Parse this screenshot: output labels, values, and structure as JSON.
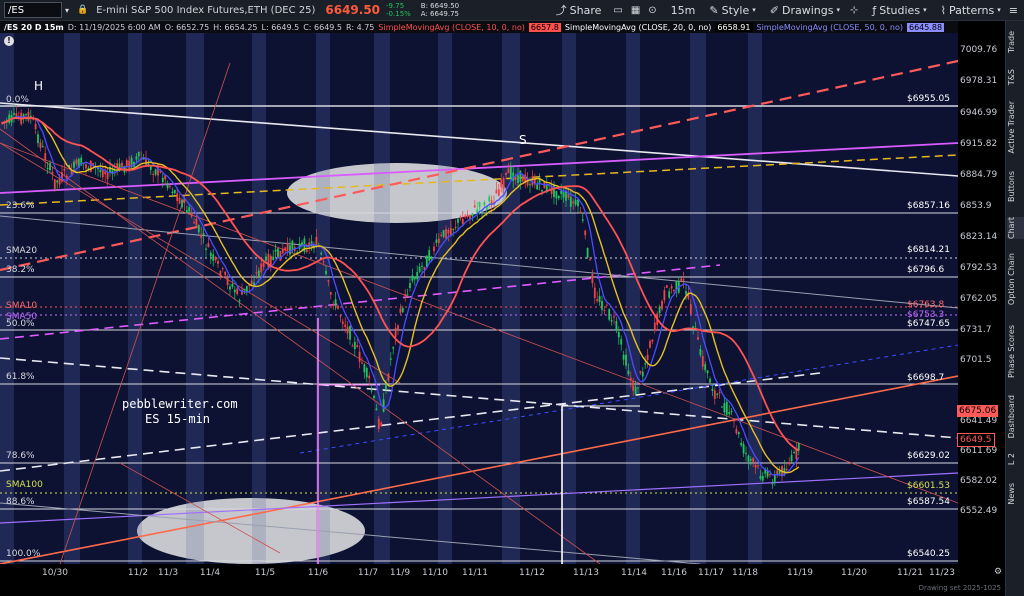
{
  "toolbar": {
    "symbol": "/ES",
    "timeframe": "/ES 20 D 15m",
    "instrument": "E-mini S&P 500 Index Futures,ETH (DEC 25)",
    "last_price": "6649.50",
    "change_1": "-9.75",
    "change_2": "-0.15%",
    "bid": "B: 6649.50",
    "ask": "A: 6649.75",
    "share_label": "Share",
    "interval_label": "15m",
    "style_label": "Style",
    "drawings_label": "Drawings",
    "studies_label": "Studies",
    "patterns_label": "Patterns"
  },
  "infobar": {
    "date": "D: 11/19/2025 6:00 AM",
    "open": "O: 6652.75",
    "high": "H: 6654.25",
    "low": "L: 6649.5",
    "close": "C: 6649.5",
    "range": "R: 4.75",
    "sma10_label": "SimpleMovingAvg (CLOSE, 10, 0, no)",
    "sma10_val": "6657.8",
    "sma20_label": "SimpleMovingAvg (CLOSE, 20, 0, no)",
    "sma20_val": "6658.91",
    "sma50_label": "SimpleMovingAvg (CLOSE, 50, 0, no)",
    "sma50_val": "6645.88"
  },
  "yaxis_ticks": [
    "7009.76",
    "6978.31",
    "6946.99",
    "6915.82",
    "6884.79",
    "6853.9",
    "6823.14",
    "6792.53",
    "6762.05",
    "6731.7",
    "6701.5",
    "6641.49",
    "6611.69",
    "6582.02",
    "6552.49"
  ],
  "xaxis_ticks": [
    "10/30",
    "11/2",
    "11/3",
    "11/4",
    "11/5",
    "11/6",
    "11/7",
    "11/9",
    "11/10",
    "11/11",
    "11/12",
    "11/13",
    "11/14",
    "11/16",
    "11/17",
    "11/18",
    "11/19",
    "11/20",
    "11/21",
    "11/23"
  ],
  "fib_levels": [
    {
      "pct": "0.0%",
      "price": "$6955.05"
    },
    {
      "pct": "23.6%",
      "price": "$6857.16"
    },
    {
      "pct": "38.2%",
      "price": "$6796.6"
    },
    {
      "pct": "50.0%",
      "price": "$6747.65"
    },
    {
      "pct": "61.8%",
      "price": "$6698.7"
    },
    {
      "pct": "78.6%",
      "price": "$6629.02"
    },
    {
      "pct": "88.6%",
      "price": "$6587.54"
    },
    {
      "pct": "100.0%",
      "price": "$6540.25"
    }
  ],
  "ma_labels": {
    "sma20": "SMA20",
    "sma20_price": "$6814.21",
    "sma10": "SMA10",
    "sma10_price": "$6763.8",
    "sma50": "SMA50",
    "sma50_price": "$6753.3",
    "sma100": "SMA100",
    "sma100_price": "$6601.53"
  },
  "price_tags": {
    "upper": "6675.06",
    "current": "6649.5"
  },
  "annotations": {
    "H": "H",
    "S": "S",
    "watermark_1": "pebblewriter.com",
    "watermark_2": "ES 15-min"
  },
  "sidebar_tabs": [
    "Trade",
    "T&S",
    "Active Trader",
    "Buttons",
    "Chart",
    "Option Chain",
    "Phase Scores",
    "Dashboard",
    "L 2",
    "News"
  ],
  "footnote": "Drawing set 2025-1025",
  "colors": {
    "background": "#0d1232",
    "sma10": "#ff4f4f",
    "sma20": "#ffffff",
    "sma50": "#c06cff",
    "price_up": "#22c55e",
    "price_down": "#ef4444"
  }
}
